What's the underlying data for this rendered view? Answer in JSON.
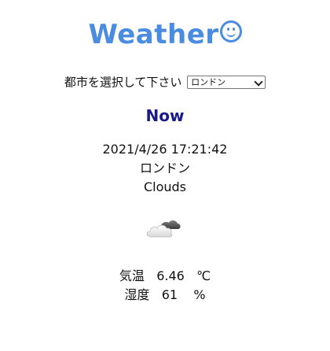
{
  "app": {
    "title": "Weather",
    "title_emoji": "smiley-face-icon"
  },
  "city_select": {
    "label": "都市を選択して下さい",
    "selected": "ロンドン"
  },
  "section": {
    "heading": "Now"
  },
  "current": {
    "datetime": "2021/4/26 17:21:42",
    "city": "ロンドン",
    "condition": "Clouds",
    "condition_icon": "cloud-icon"
  },
  "stats": {
    "temp_label": "気温",
    "temp_value": "6.46",
    "temp_unit": "℃",
    "humidity_label": "湿度",
    "humidity_value": "61",
    "humidity_unit": "%"
  },
  "colors": {
    "title": "#4a8ce0",
    "heading": "#1a1a8a",
    "text": "#111111"
  }
}
